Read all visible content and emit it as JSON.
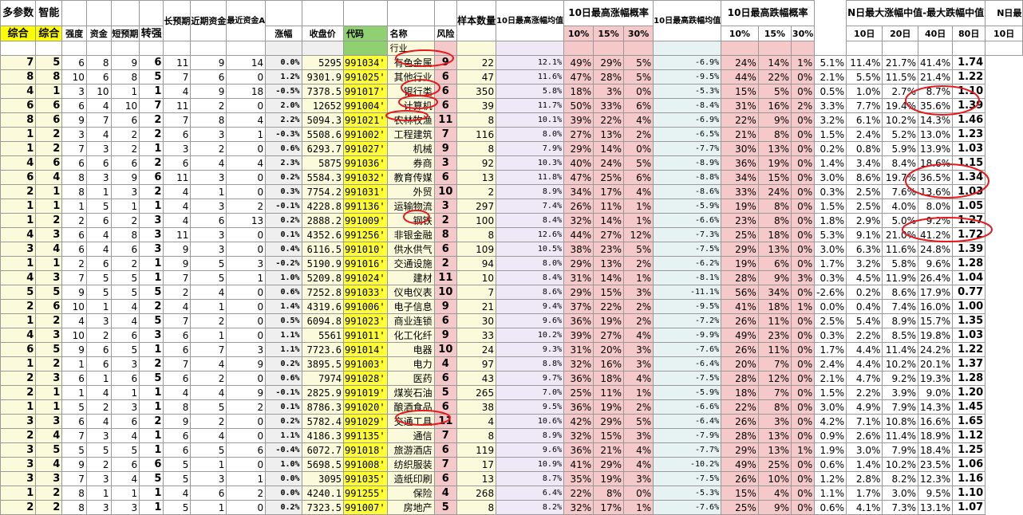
{
  "headers": {
    "top": [
      "多参数",
      "智能",
      "",
      "",
      "",
      "",
      "长预期",
      "近期资金",
      "最近资金A",
      "",
      "",
      "",
      "",
      "",
      "样本数量",
      "10日最高涨幅均值",
      "10日最高涨幅概率",
      "10日最高跌幅均值",
      "10日最高跌幅概率",
      "N日最大涨幅中值-最大跌幅中值",
      "N日最"
    ],
    "sub": [
      "综合",
      "综合",
      "强度",
      "资金",
      "短预期",
      "转强",
      "",
      "",
      "",
      "涨幅",
      "收盘价",
      "代码",
      "名称",
      "风险",
      "",
      "",
      "10%",
      "15%",
      "30%",
      "",
      "10%",
      "15%",
      "30%",
      "10日",
      "20日",
      "40日",
      "80日",
      "10日"
    ],
    "first_row_name": "行业"
  },
  "rows": [
    {
      "a": "7",
      "b": "5",
      "c": "6",
      "d": "8",
      "e": "9",
      "f": "6",
      "g": "11",
      "h": "9",
      "i": "14",
      "chg": "0.0%",
      "close": "5295",
      "code": "991034'",
      "name": "有色金属",
      "risk": "9",
      "n": "22",
      "up": "12.1%",
      "p10": "49%",
      "p15": "29%",
      "p30": "5%",
      "dn": "-6.9%",
      "q10": "24%",
      "q15": "14%",
      "q30": "1%",
      "m10": "5.1%",
      "m20": "11.4%",
      "m40": "21.7%",
      "m80": "41.4%",
      "last": "1.74"
    },
    {
      "a": "8",
      "b": "8",
      "c": "10",
      "d": "6",
      "e": "8",
      "f": "5",
      "g": "7",
      "h": "6",
      "i": "0",
      "chg": "1.2%",
      "close": "9301.9",
      "code": "991025'",
      "name": "其他行业",
      "risk": "6",
      "n": "47",
      "up": "11.6%",
      "p10": "47%",
      "p15": "28%",
      "p30": "5%",
      "dn": "-9.5%",
      "q10": "44%",
      "q15": "22%",
      "q30": "0%",
      "m10": "2.1%",
      "m20": "5.5%",
      "m40": "11.5%",
      "m80": "21.4%",
      "last": "1.22"
    },
    {
      "a": "4",
      "b": "1",
      "c": "3",
      "d": "10",
      "e": "1",
      "f": "1",
      "g": "4",
      "h": "9",
      "i": "18",
      "chg": "-0.5%",
      "close": "7378.5",
      "code": "991017'",
      "name": "银行类",
      "risk": "6",
      "n": "350",
      "up": "5.8%",
      "p10": "18%",
      "p15": "3%",
      "p30": "0%",
      "dn": "-5.3%",
      "q10": "15%",
      "q15": "5%",
      "q30": "0%",
      "m10": "0.5%",
      "m20": "1.0%",
      "m40": "2.7%",
      "m80": "8.7%",
      "last": "1.10"
    },
    {
      "a": "6",
      "b": "6",
      "c": "6",
      "d": "4",
      "e": "10",
      "f": "7",
      "g": "11",
      "h": "2",
      "i": "0",
      "chg": "2.0%",
      "close": "12652",
      "code": "991004'",
      "name": "计算机",
      "risk": "6",
      "n": "39",
      "up": "11.7%",
      "p10": "50%",
      "p15": "33%",
      "p30": "6%",
      "dn": "-8.4%",
      "q10": "31%",
      "q15": "16%",
      "q30": "2%",
      "m10": "3.3%",
      "m20": "7.7%",
      "m40": "19.4%",
      "m80": "35.6%",
      "last": "1.39"
    },
    {
      "a": "8",
      "b": "6",
      "c": "9",
      "d": "7",
      "e": "6",
      "f": "2",
      "g": "7",
      "h": "8",
      "i": "4",
      "chg": "2.2%",
      "close": "5094.3",
      "code": "991021'",
      "name": "农林牧渔",
      "risk": "11",
      "n": "8",
      "up": "10.1%",
      "p10": "39%",
      "p15": "22%",
      "p30": "4%",
      "dn": "-6.9%",
      "q10": "22%",
      "q15": "9%",
      "q30": "0%",
      "m10": "3.2%",
      "m20": "6.1%",
      "m40": "10.2%",
      "m80": "14.3%",
      "last": "1.46"
    },
    {
      "a": "1",
      "b": "2",
      "c": "3",
      "d": "4",
      "e": "2",
      "f": "2",
      "g": "6",
      "h": "3",
      "i": "1",
      "chg": "-0.3%",
      "close": "5508.6",
      "code": "991002'",
      "name": "工程建筑",
      "risk": "7",
      "n": "116",
      "up": "8.0%",
      "p10": "27%",
      "p15": "13%",
      "p30": "2%",
      "dn": "-6.5%",
      "q10": "21%",
      "q15": "8%",
      "q30": "0%",
      "m10": "1.5%",
      "m20": "2.4%",
      "m40": "5.2%",
      "m80": "13.0%",
      "last": "1.23"
    },
    {
      "a": "1",
      "b": "2",
      "c": "7",
      "d": "3",
      "e": "2",
      "f": "1",
      "g": "3",
      "h": "2",
      "i": "0",
      "chg": "0.6%",
      "close": "6293.7",
      "code": "991027'",
      "name": "机械",
      "risk": "9",
      "n": "8",
      "up": "7.9%",
      "p10": "29%",
      "p15": "14%",
      "p30": "0%",
      "dn": "-7.7%",
      "q10": "30%",
      "q15": "13%",
      "q30": "0%",
      "m10": "0.2%",
      "m20": "0.8%",
      "m40": "5.9%",
      "m80": "13.9%",
      "last": "1.03"
    },
    {
      "a": "4",
      "b": "6",
      "c": "6",
      "d": "6",
      "e": "6",
      "f": "2",
      "g": "6",
      "h": "4",
      "i": "4",
      "chg": "2.3%",
      "close": "5875",
      "code": "991036'",
      "name": "券商",
      "risk": "3",
      "n": "92",
      "up": "10.3%",
      "p10": "40%",
      "p15": "24%",
      "p30": "5%",
      "dn": "-8.9%",
      "q10": "36%",
      "q15": "19%",
      "q30": "0%",
      "m10": "1.4%",
      "m20": "3.4%",
      "m40": "8.4%",
      "m80": "18.6%",
      "last": "1.15"
    },
    {
      "a": "6",
      "b": "4",
      "c": "8",
      "d": "3",
      "e": "9",
      "f": "6",
      "g": "11",
      "h": "3",
      "i": "0",
      "chg": "0.2%",
      "close": "5584.3",
      "code": "991032'",
      "name": "教育传媒",
      "risk": "6",
      "n": "13",
      "up": "11.8%",
      "p10": "47%",
      "p15": "25%",
      "p30": "6%",
      "dn": "-8.8%",
      "q10": "34%",
      "q15": "15%",
      "q30": "0%",
      "m10": "3.0%",
      "m20": "8.6%",
      "m40": "19.7%",
      "m80": "36.5%",
      "last": "1.34"
    },
    {
      "a": "2",
      "b": "1",
      "c": "8",
      "d": "1",
      "e": "3",
      "f": "2",
      "g": "4",
      "h": "1",
      "i": "0",
      "chg": "0.3%",
      "close": "7754.2",
      "code": "991031'",
      "name": "外贸",
      "risk": "10",
      "n": "2",
      "up": "8.9%",
      "p10": "34%",
      "p15": "17%",
      "p30": "4%",
      "dn": "-8.6%",
      "q10": "33%",
      "q15": "24%",
      "q30": "0%",
      "m10": "0.3%",
      "m20": "2.5%",
      "m40": "7.6%",
      "m80": "13.6%",
      "last": "1.03"
    },
    {
      "a": "1",
      "b": "1",
      "c": "1",
      "d": "5",
      "e": "1",
      "f": "1",
      "g": "4",
      "h": "3",
      "i": "2",
      "chg": "-0.1%",
      "close": "4228.8",
      "code": "991136'",
      "name": "运输物流",
      "risk": "3",
      "n": "297",
      "up": "7.4%",
      "p10": "26%",
      "p15": "11%",
      "p30": "1%",
      "dn": "-5.9%",
      "q10": "19%",
      "q15": "8%",
      "q30": "0%",
      "m10": "1.5%",
      "m20": "2.5%",
      "m40": "4.0%",
      "m80": "8.0%",
      "last": "1.05"
    },
    {
      "a": "1",
      "b": "2",
      "c": "2",
      "d": "6",
      "e": "2",
      "f": "3",
      "g": "4",
      "h": "6",
      "i": "13",
      "chg": "0.2%",
      "close": "2888.2",
      "code": "991009'",
      "name": "钢铁",
      "risk": "2",
      "n": "100",
      "up": "8.4%",
      "p10": "32%",
      "p15": "14%",
      "p30": "1%",
      "dn": "-6.6%",
      "q10": "23%",
      "q15": "8%",
      "q30": "0%",
      "m10": "1.8%",
      "m20": "2.9%",
      "m40": "5.0%",
      "m80": "9.2%",
      "last": "1.27"
    },
    {
      "a": "4",
      "b": "3",
      "c": "6",
      "d": "4",
      "e": "8",
      "f": "3",
      "g": "11",
      "h": "3",
      "i": "0",
      "chg": "0.1%",
      "close": "4352.6",
      "code": "991256'",
      "name": "非银金融",
      "risk": "8",
      "n": "8",
      "up": "12.6%",
      "p10": "44%",
      "p15": "27%",
      "p30": "12%",
      "dn": "-7.3%",
      "q10": "25%",
      "q15": "18%",
      "q30": "0%",
      "m10": "5.3%",
      "m20": "9.1%",
      "m40": "21.0%",
      "m80": "41.2%",
      "last": "1.72"
    },
    {
      "a": "3",
      "b": "4",
      "c": "6",
      "d": "4",
      "e": "6",
      "f": "3",
      "g": "9",
      "h": "3",
      "i": "0",
      "chg": "0.4%",
      "close": "6116.5",
      "code": "991010'",
      "name": "供水供气",
      "risk": "6",
      "n": "109",
      "up": "10.5%",
      "p10": "38%",
      "p15": "23%",
      "p30": "5%",
      "dn": "-7.5%",
      "q10": "29%",
      "q15": "13%",
      "q30": "0%",
      "m10": "3.0%",
      "m20": "6.3%",
      "m40": "11.6%",
      "m80": "24.8%",
      "last": "1.39"
    },
    {
      "a": "1",
      "b": "1",
      "c": "2",
      "d": "6",
      "e": "2",
      "f": "1",
      "g": "9",
      "h": "5",
      "i": "3",
      "chg": "-0.2%",
      "close": "5190.9",
      "code": "991016'",
      "name": "交通设施",
      "risk": "2",
      "n": "94",
      "up": "8.0%",
      "p10": "29%",
      "p15": "13%",
      "p30": "2%",
      "dn": "-6.2%",
      "q10": "19%",
      "q15": "6%",
      "q30": "0%",
      "m10": "1.7%",
      "m20": "3.2%",
      "m40": "5.8%",
      "m80": "9.6%",
      "last": "1.28"
    },
    {
      "a": "4",
      "b": "3",
      "c": "7",
      "d": "5",
      "e": "5",
      "f": "1",
      "g": "7",
      "h": "5",
      "i": "1",
      "chg": "1.0%",
      "close": "5209.8",
      "code": "991024'",
      "name": "建材",
      "risk": "11",
      "n": "10",
      "up": "8.4%",
      "p10": "31%",
      "p15": "14%",
      "p30": "1%",
      "dn": "-8.1%",
      "q10": "28%",
      "q15": "9%",
      "q30": "3%",
      "m10": "0.3%",
      "m20": "4.5%",
      "m40": "11.9%",
      "m80": "26.4%",
      "last": "1.04"
    },
    {
      "a": "5",
      "b": "5",
      "c": "9",
      "d": "5",
      "e": "5",
      "f": "5",
      "g": "2",
      "h": "4",
      "i": "0",
      "chg": "0.6%",
      "close": "7252.8",
      "code": "991033'",
      "name": "仪电仪表",
      "risk": "10",
      "n": "7",
      "up": "8.6%",
      "p10": "29%",
      "p15": "15%",
      "p30": "3%",
      "dn": "-11.1%",
      "q10": "56%",
      "q15": "34%",
      "q30": "0%",
      "m10": "-2.6%",
      "m20": "0.2%",
      "m40": "8.6%",
      "m80": "17.9%",
      "last": "0.77"
    },
    {
      "a": "2",
      "b": "6",
      "c": "10",
      "d": "1",
      "e": "4",
      "f": "2",
      "g": "4",
      "h": "1",
      "i": "0",
      "chg": "1.4%",
      "close": "4319.6",
      "code": "991006'",
      "name": "电子信息",
      "risk": "9",
      "n": "21",
      "up": "9.4%",
      "p10": "37%",
      "p15": "22%",
      "p30": "2%",
      "dn": "-9.5%",
      "q10": "41%",
      "q15": "18%",
      "q30": "1%",
      "m10": "0.0%",
      "m20": "0.4%",
      "m40": "7.4%",
      "m80": "16.0%",
      "last": "1.00"
    },
    {
      "a": "1",
      "b": "2",
      "c": "4",
      "d": "3",
      "e": "4",
      "f": "5",
      "g": "7",
      "h": "2",
      "i": "0",
      "chg": "0.5%",
      "close": "6094.8",
      "code": "991023'",
      "name": "商业连锁",
      "risk": "6",
      "n": "30",
      "up": "9.6%",
      "p10": "36%",
      "p15": "19%",
      "p30": "2%",
      "dn": "-7.2%",
      "q10": "26%",
      "q15": "11%",
      "q30": "0%",
      "m10": "2.5%",
      "m20": "5.4%",
      "m40": "8.9%",
      "m80": "15.7%",
      "last": "1.35"
    },
    {
      "a": "4",
      "b": "3",
      "c": "10",
      "d": "2",
      "e": "6",
      "f": "3",
      "g": "6",
      "h": "1",
      "i": "0",
      "chg": "1.1%",
      "close": "5561",
      "code": "991011'",
      "name": "化工化纤",
      "risk": "9",
      "n": "33",
      "up": "10.2%",
      "p10": "39%",
      "p15": "27%",
      "p30": "4%",
      "dn": "-9.9%",
      "q10": "49%",
      "q15": "23%",
      "q30": "0%",
      "m10": "0.3%",
      "m20": "2.2%",
      "m40": "8.5%",
      "m80": "19.8%",
      "last": "1.03"
    },
    {
      "a": "6",
      "b": "5",
      "c": "9",
      "d": "6",
      "e": "5",
      "f": "1",
      "g": "6",
      "h": "7",
      "i": "3",
      "chg": "1.1%",
      "close": "7723.6",
      "code": "991014'",
      "name": "电器",
      "risk": "10",
      "n": "24",
      "up": "9.3%",
      "p10": "31%",
      "p15": "20%",
      "p30": "3%",
      "dn": "-7.6%",
      "q10": "26%",
      "q15": "11%",
      "q30": "0%",
      "m10": "1.7%",
      "m20": "4.4%",
      "m40": "11.4%",
      "m80": "24.2%",
      "last": "1.22"
    },
    {
      "a": "1",
      "b": "2",
      "c": "1",
      "d": "6",
      "e": "3",
      "f": "2",
      "g": "7",
      "h": "4",
      "i": "9",
      "chg": "0.2%",
      "close": "3895.5",
      "code": "991003'",
      "name": "电力",
      "risk": "4",
      "n": "97",
      "up": "8.8%",
      "p10": "32%",
      "p15": "16%",
      "p30": "3%",
      "dn": "-6.4%",
      "q10": "20%",
      "q15": "7%",
      "q30": "0%",
      "m10": "2.4%",
      "m20": "4.4%",
      "m40": "10.2%",
      "m80": "20.1%",
      "last": "1.37"
    },
    {
      "a": "2",
      "b": "3",
      "c": "6",
      "d": "1",
      "e": "6",
      "f": "5",
      "g": "6",
      "h": "2",
      "i": "0",
      "chg": "0.6%",
      "close": "7974",
      "code": "991028'",
      "name": "医药",
      "risk": "6",
      "n": "43",
      "up": "9.7%",
      "p10": "36%",
      "p15": "18%",
      "p30": "4%",
      "dn": "-7.5%",
      "q10": "28%",
      "q15": "12%",
      "q30": "0%",
      "m10": "2.1%",
      "m20": "4.7%",
      "m40": "9.2%",
      "m80": "19.3%",
      "last": "1.28"
    },
    {
      "a": "2",
      "b": "1",
      "c": "1",
      "d": "4",
      "e": "1",
      "f": "1",
      "g": "4",
      "h": "4",
      "i": "9",
      "chg": "-0.1%",
      "close": "2825.9",
      "code": "991019'",
      "name": "煤炭石油",
      "risk": "5",
      "n": "265",
      "up": "7.0%",
      "p10": "25%",
      "p15": "11%",
      "p30": "1%",
      "dn": "-5.9%",
      "q10": "18%",
      "q15": "7%",
      "q30": "0%",
      "m10": "1.5%",
      "m20": "2.2%",
      "m40": "3.9%",
      "m80": "9.0%",
      "last": "1.20"
    },
    {
      "a": "1",
      "b": "1",
      "c": "5",
      "d": "2",
      "e": "3",
      "f": "1",
      "g": "8",
      "h": "5",
      "i": "2",
      "chg": "0.1%",
      "close": "8786.3",
      "code": "991020'",
      "name": "酿酒食品",
      "risk": "6",
      "n": "38",
      "up": "9.5%",
      "p10": "36%",
      "p15": "19%",
      "p30": "2%",
      "dn": "-6.6%",
      "q10": "22%",
      "q15": "8%",
      "q30": "0%",
      "m10": "3.0%",
      "m20": "4.9%",
      "m40": "7.9%",
      "m80": "14.3%",
      "last": "1.45"
    },
    {
      "a": "3",
      "b": "3",
      "c": "6",
      "d": "4",
      "e": "6",
      "f": "2",
      "g": "9",
      "h": "2",
      "i": "0",
      "chg": "0.2%",
      "close": "5782.4",
      "code": "991029'",
      "name": "交通工具",
      "risk": "11",
      "n": "4",
      "up": "10.6%",
      "p10": "42%",
      "p15": "29%",
      "p30": "5%",
      "dn": "-6.4%",
      "q10": "26%",
      "q15": "3%",
      "q30": "0%",
      "m10": "4.2%",
      "m20": "7.1%",
      "m40": "10.8%",
      "m80": "16.6%",
      "last": "1.65"
    },
    {
      "a": "2",
      "b": "4",
      "c": "7",
      "d": "3",
      "e": "4",
      "f": "1",
      "g": "6",
      "h": "4",
      "i": "0",
      "chg": "1.1%",
      "close": "4186.3",
      "code": "991135'",
      "name": "通信",
      "risk": "7",
      "n": "8",
      "up": "8.9%",
      "p10": "32%",
      "p15": "15%",
      "p30": "3%",
      "dn": "-7.9%",
      "q10": "28%",
      "q15": "13%",
      "q30": "0%",
      "m10": "0.9%",
      "m20": "2.6%",
      "m40": "11.4%",
      "m80": "18.9%",
      "last": "1.12"
    },
    {
      "a": "3",
      "b": "5",
      "c": "5",
      "d": "5",
      "e": "5",
      "f": "1",
      "g": "6",
      "h": "5",
      "i": "6",
      "chg": "-0.4%",
      "close": "6072.7",
      "code": "991018'",
      "name": "旅游酒店",
      "risk": "6",
      "n": "119",
      "up": "9.6%",
      "p10": "36%",
      "p15": "21%",
      "p30": "4%",
      "dn": "-7.7%",
      "q10": "29%",
      "q15": "13%",
      "q30": "1%",
      "m10": "1.9%",
      "m20": "3.0%",
      "m40": "7.9%",
      "m80": "18.4%",
      "last": "1.25"
    },
    {
      "a": "3",
      "b": "4",
      "c": "9",
      "d": "2",
      "e": "6",
      "f": "6",
      "g": "5",
      "h": "1",
      "i": "0",
      "chg": "1.0%",
      "close": "5698.5",
      "code": "991008'",
      "name": "纺织服装",
      "risk": "7",
      "n": "17",
      "up": "10.9%",
      "p10": "41%",
      "p15": "29%",
      "p30": "4%",
      "dn": "-10.2%",
      "q10": "49%",
      "q15": "25%",
      "q30": "0%",
      "m10": "0.6%",
      "m20": "1.4%",
      "m40": "10.2%",
      "m80": "23.5%",
      "last": "1.06"
    },
    {
      "a": "3",
      "b": "3",
      "c": "7",
      "d": "3",
      "e": "4",
      "f": "5",
      "g": "5",
      "h": "3",
      "i": "1",
      "chg": "0.0%",
      "close": "3095",
      "code": "991035'",
      "name": "造纸印刷",
      "risk": "6",
      "n": "13",
      "up": "8.7%",
      "p10": "35%",
      "p15": "19%",
      "p30": "3%",
      "dn": "-7.5%",
      "q10": "26%",
      "q15": "10%",
      "q30": "0%",
      "m10": "1.2%",
      "m20": "2.8%",
      "m40": "8.2%",
      "m80": "12.3%",
      "last": "1.16"
    },
    {
      "a": "1",
      "b": "2",
      "c": "8",
      "d": "1",
      "e": "1",
      "f": "1",
      "g": "4",
      "h": "6",
      "i": "2",
      "chg": "0.0%",
      "close": "4240.1",
      "code": "991255'",
      "name": "保险",
      "risk": "4",
      "n": "268",
      "up": "6.4%",
      "p10": "22%",
      "p15": "8%",
      "p30": "0%",
      "dn": "-5.3%",
      "q10": "15%",
      "q15": "4%",
      "q30": "0%",
      "m10": "1.1%",
      "m20": "1.7%",
      "m40": "3.0%",
      "m80": "9.5%",
      "last": "1.10"
    },
    {
      "a": "2",
      "b": "2",
      "c": "8",
      "d": "3",
      "e": "3",
      "f": "1",
      "g": "5",
      "h": "1",
      "i": "0",
      "chg": "0.2%",
      "close": "7323.5",
      "code": "991007'",
      "name": "房地产",
      "risk": "5",
      "n": "8",
      "up": "8.2%",
      "p10": "32%",
      "p15": "17%",
      "p30": "1%",
      "dn": "-7.6%",
      "q10": "25%",
      "q15": "9%",
      "q30": "0%",
      "m10": "0.6%",
      "m20": "4.1%",
      "m40": "7.3%",
      "m80": "13.1%",
      "last": "1.07"
    }
  ],
  "colors": {
    "red": "#e00000",
    "magenta": "#d41ad4",
    "blue": "#2020ee",
    "green": "#00a000",
    "annotation": "#e8181c"
  }
}
